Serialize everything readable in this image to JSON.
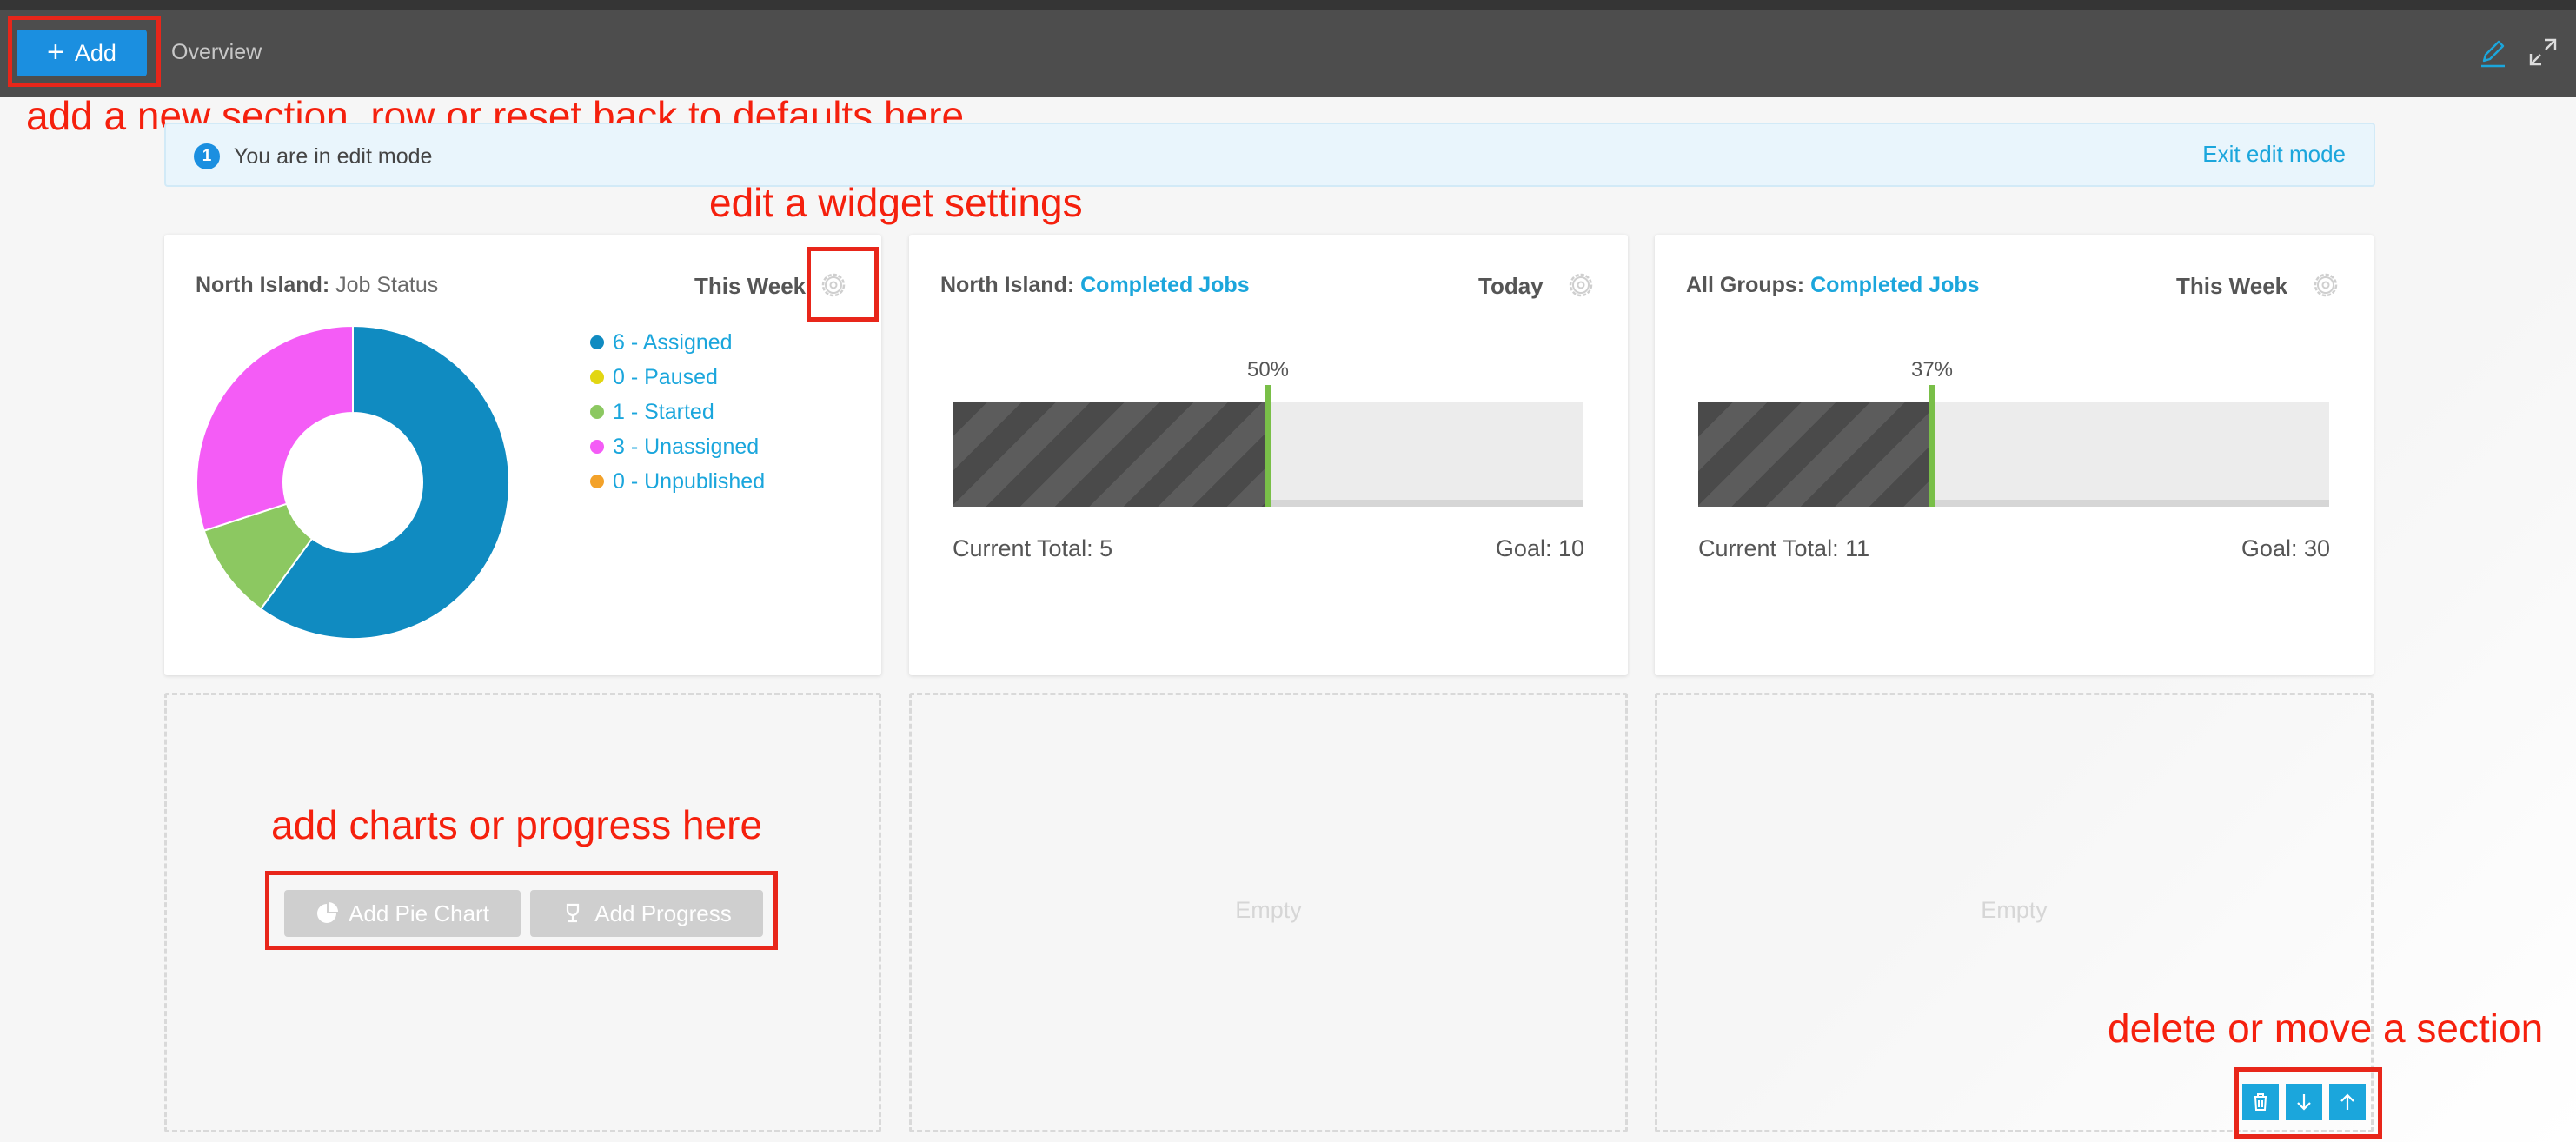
{
  "toolbar": {
    "add_label": "Add",
    "overview_label": "Overview",
    "icons": [
      "plus-icon",
      "pencil-icon",
      "expand-icon"
    ]
  },
  "annotations": {
    "add_section": "add a new section, row or reset back to defaults here",
    "edit_widget": "edit a widget settings",
    "add_charts": "add charts or progress here",
    "delete_move": "delete or move a section",
    "box_color": "#e8261a"
  },
  "notice": {
    "badge": "1",
    "text": "You are in edit mode",
    "exit_label": "Exit edit mode"
  },
  "widgets": [
    {
      "group": "North Island:",
      "title": "Job Status",
      "period": "This Week",
      "chart_data": {
        "type": "pie",
        "donut": true,
        "slices": [
          {
            "label": "6 - Assigned",
            "value": 6,
            "color": "#108bc1"
          },
          {
            "label": "0 - Paused",
            "value": 0,
            "color": "#e2d612"
          },
          {
            "label": "1 - Started",
            "value": 1,
            "color": "#8cc861"
          },
          {
            "label": "3 - Unassigned",
            "value": 3,
            "color": "#f45cf6"
          },
          {
            "label": "0 - Unpublished",
            "value": 0,
            "color": "#f3a22a"
          }
        ]
      }
    },
    {
      "group": "North Island:",
      "title": "Completed Jobs",
      "period": "Today",
      "percent_label": "50%",
      "progress": 0.5,
      "current_label": "Current Total: 5",
      "goal_label": "Goal: 10"
    },
    {
      "group": "All Groups:",
      "title": "Completed Jobs",
      "period": "This Week",
      "percent_label": "37%",
      "progress": 0.37,
      "current_label": "Current Total: 11",
      "goal_label": "Goal: 30"
    }
  ],
  "empty_slots": {
    "add_pie_label": "Add Pie Chart",
    "add_progress_label": "Add Progress",
    "empty_label": "Empty"
  },
  "section_controls": [
    "trash-icon",
    "arrow-down-icon",
    "arrow-up-icon"
  ],
  "colors": {
    "accent": "#1b8fe0",
    "link": "#1ba6dc",
    "annotation": "#f5200d",
    "progress_marker": "#79bf48"
  }
}
